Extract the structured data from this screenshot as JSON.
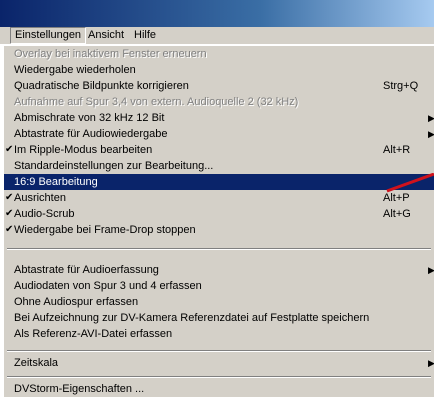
{
  "menubar": {
    "items": [
      {
        "label": "Einstellungen"
      },
      {
        "label": "Ansicht"
      },
      {
        "label": "Hilfe"
      }
    ]
  },
  "menu": {
    "items": [
      {
        "label": "Overlay bei inaktivem Fenster erneuern",
        "shortcut": "",
        "checked": false,
        "disabled": true,
        "submenu": false
      },
      {
        "label": "Wiedergabe wiederholen",
        "shortcut": "",
        "checked": false,
        "disabled": false,
        "submenu": false
      },
      {
        "label": "Quadratische Bildpunkte korrigieren",
        "shortcut": "Strg+Q",
        "checked": false,
        "disabled": false,
        "submenu": false
      },
      {
        "label": "Aufnahme auf Spur 3,4 von extern. Audioquelle 2 (32 kHz)",
        "shortcut": "",
        "checked": false,
        "disabled": true,
        "submenu": false
      },
      {
        "label": "Abmischrate von 32 kHz 12 Bit",
        "shortcut": "",
        "checked": false,
        "disabled": false,
        "submenu": true
      },
      {
        "label": "Abtastrate für Audiowiedergabe",
        "shortcut": "",
        "checked": false,
        "disabled": false,
        "submenu": true
      },
      {
        "label": "Im Ripple-Modus bearbeiten",
        "shortcut": "Alt+R",
        "checked": true,
        "disabled": false,
        "submenu": false
      },
      {
        "label": "Standardeinstellungen zur Bearbeitung...",
        "shortcut": "",
        "checked": false,
        "disabled": false,
        "submenu": false
      },
      {
        "label": "16:9 Bearbeitung",
        "shortcut": "",
        "checked": false,
        "disabled": false,
        "submenu": false,
        "selected": true
      },
      {
        "label": "Ausrichten",
        "shortcut": "Alt+P",
        "checked": true,
        "disabled": false,
        "submenu": false
      },
      {
        "label": "Audio-Scrub",
        "shortcut": "Alt+G",
        "checked": true,
        "disabled": false,
        "submenu": false
      },
      {
        "label": "Wiedergabe bei Frame-Drop stoppen",
        "shortcut": "",
        "checked": true,
        "disabled": false,
        "submenu": false
      },
      {
        "label": "Abtastrate für Audioerfassung",
        "shortcut": "",
        "checked": false,
        "disabled": false,
        "submenu": true
      },
      {
        "label": "Audiodaten von Spur 3 und 4 erfassen",
        "shortcut": "",
        "checked": false,
        "disabled": false,
        "submenu": false
      },
      {
        "label": "Ohne Audiospur erfassen",
        "shortcut": "",
        "checked": false,
        "disabled": false,
        "submenu": false
      },
      {
        "label": "Bei Aufzeichnung zur DV-Kamera Referenzdatei auf Festplatte speichern",
        "shortcut": "",
        "checked": false,
        "disabled": false,
        "submenu": false
      },
      {
        "label": "Als Referenz-AVI-Datei erfassen",
        "shortcut": "",
        "checked": false,
        "disabled": false,
        "submenu": false
      },
      {
        "label": "Zeitskala",
        "shortcut": "",
        "checked": false,
        "disabled": false,
        "submenu": true
      },
      {
        "label": "DVStorm-Eigenschaften ...",
        "shortcut": "",
        "checked": false,
        "disabled": false,
        "submenu": false
      }
    ]
  },
  "icons": {
    "check": "checkmark-icon",
    "submenu": "submenu-arrow-icon"
  },
  "colors": {
    "menu_bg": "#d4d0c8",
    "selection_bg": "#0a246a",
    "annotation": "#d0121c"
  }
}
